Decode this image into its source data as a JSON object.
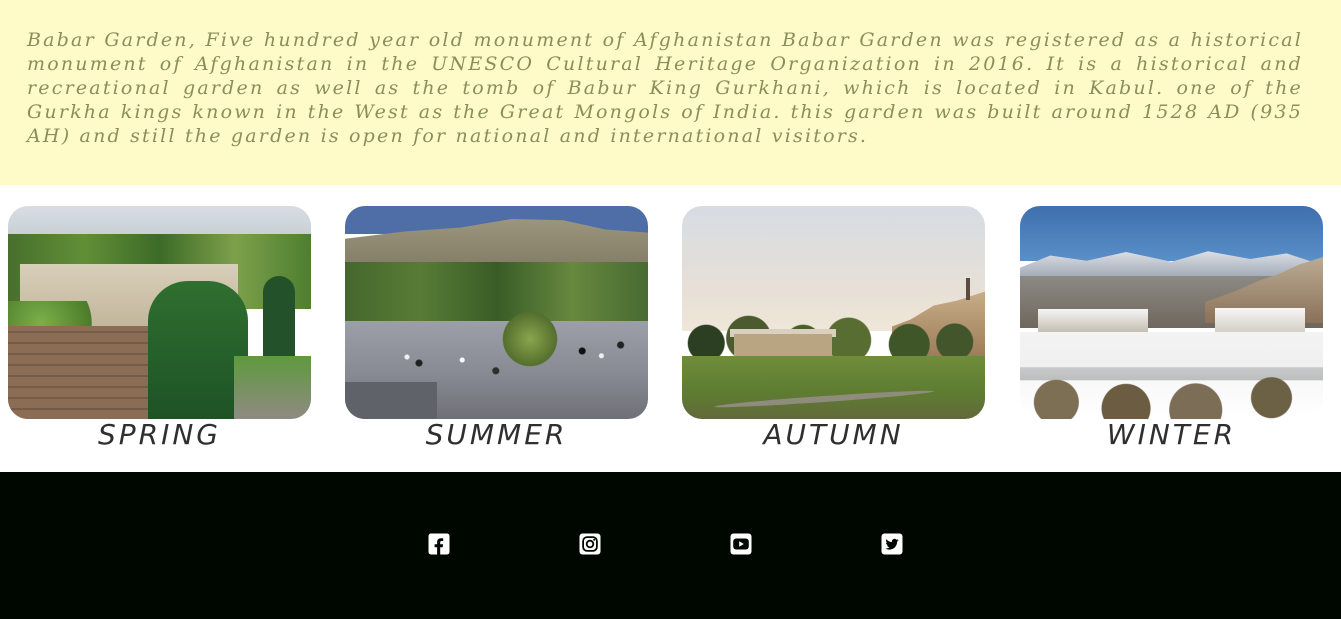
{
  "intro": {
    "text": "Babar Garden, Five hundred year old monument of Afghanistan Babar Garden was registered as a historical monument of Afghanistan in the UNESCO Cultural Heritage Organization in 2016. It is a historical and recreational garden as well as the tomb of Babur King Gurkhani, which is located in Kabul. one of the Gurkha kings known in the West as the Great Mongols of India. this garden was built around 1528 AD (935 AH) and still the garden is open for national and international visitors."
  },
  "seasons": [
    {
      "label": "SPRING",
      "icon": "spring-garden-photo"
    },
    {
      "label": "SUMMER",
      "icon": "summer-garden-photo"
    },
    {
      "label": "AUTUMN",
      "icon": "autumn-garden-photo"
    },
    {
      "label": "WINTER",
      "icon": "winter-garden-photo"
    }
  ],
  "footer": {
    "social_icons": [
      "facebook-icon",
      "instagram-icon",
      "youtube-icon",
      "twitter-icon"
    ]
  },
  "colors": {
    "intro_background": "#fefbc8",
    "intro_text": "#8a8f5a",
    "footer_background": "#000700",
    "label_text": "#2f2f2f"
  }
}
